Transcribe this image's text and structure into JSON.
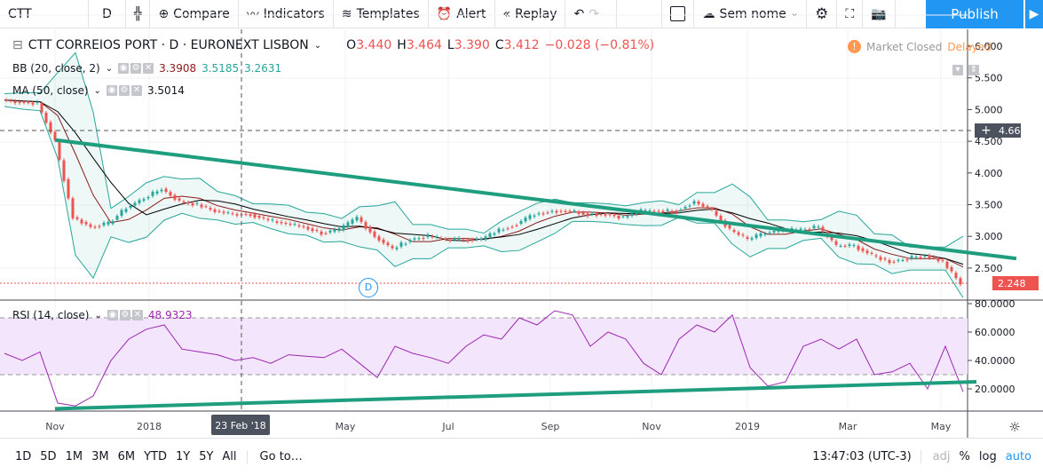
{
  "toolbar": {
    "symbol": "CTT",
    "interval": "D",
    "compare": "Compare",
    "indicators": "Indicators",
    "templates": "Templates",
    "alert": "Alert",
    "replay": "Replay",
    "layout_name": "Sem nome",
    "publish": "Publish"
  },
  "legend": {
    "title": "CTT CORREIOS PORT · D · EURONEXT LISBON",
    "o_label": "O",
    "o": "3.440",
    "h_label": "H",
    "h": "3.464",
    "l_label": "L",
    "l": "3.390",
    "c_label": "C",
    "c": "3.412",
    "change": "−0.028 (−0.81%)",
    "market_status": "Market Closed",
    "delayed": "Delayed",
    "bb": {
      "label": "BB (20, close, 2)",
      "basis": "3.3908",
      "upper": "3.5185",
      "lower": "3.2631"
    },
    "ma": {
      "label": "MA (50, close)",
      "value": "3.5014"
    },
    "rsi": {
      "label": "RSI (14, close)",
      "value": "48.9323"
    }
  },
  "price_axis": {
    "ticks": [
      "6.000",
      "5.500",
      "5.000",
      "4.500",
      "4.000",
      "3.500",
      "3.000",
      "2.500"
    ],
    "crosshair_label": "4.660",
    "last_price": "2.248"
  },
  "rsi_axis": {
    "ticks": [
      "80.0000",
      "60.0000",
      "40.0000",
      "20.0000"
    ]
  },
  "time_axis": {
    "ticks": [
      "Nov",
      "2018",
      "May",
      "Jul",
      "Sep",
      "Nov",
      "2019",
      "Mar",
      "May"
    ],
    "crosshair_label": "23 Feb '18"
  },
  "dividend_marker": "D",
  "bottom": {
    "ranges": [
      "1D",
      "5D",
      "1M",
      "3M",
      "6M",
      "YTD",
      "1Y",
      "5Y",
      "All"
    ],
    "goto": "Go to…",
    "clock": "13:47:03 (UTC-3)",
    "adj": "adj",
    "pct": "%",
    "log": "log",
    "auto": "auto"
  },
  "colors": {
    "up": "#26a69a",
    "down": "#ef5350",
    "trend": "#1e9e7e",
    "bb": "#26a69a",
    "rsi": "#9c27b0",
    "accent": "#2196f3"
  },
  "chart_data": {
    "type": "line",
    "title": "CTT CORREIOS PORT · D · EURONEXT LISBON",
    "ylim": [
      2.1,
      6.2
    ],
    "price_close": [
      5.15,
      5.12,
      5.1,
      4.5,
      3.3,
      3.15,
      3.2,
      3.45,
      3.6,
      3.75,
      3.55,
      3.5,
      3.4,
      3.35,
      3.35,
      3.25,
      3.2,
      3.15,
      3.05,
      3.1,
      3.3,
      3.0,
      2.8,
      2.95,
      3.0,
      2.95,
      2.95,
      2.95,
      3.1,
      3.2,
      3.35,
      3.4,
      3.4,
      3.35,
      3.35,
      3.3,
      3.4,
      3.4,
      3.4,
      3.55,
      3.4,
      3.1,
      2.95,
      3.05,
      3.1,
      3.1,
      3.15,
      2.85,
      2.85,
      2.7,
      2.6,
      2.65,
      2.7,
      2.6,
      2.25
    ],
    "rsi": [
      45,
      40,
      46,
      10,
      8,
      15,
      40,
      55,
      62,
      65,
      48,
      46,
      44,
      40,
      42,
      38,
      44,
      43,
      42,
      48,
      38,
      28,
      50,
      45,
      42,
      38,
      50,
      58,
      55,
      70,
      65,
      75,
      72,
      50,
      60,
      55,
      38,
      30,
      55,
      65,
      60,
      72,
      35,
      22,
      25,
      50,
      55,
      48,
      55,
      30,
      32,
      38,
      20,
      50,
      18
    ],
    "trendlines": [
      {
        "pane": "price",
        "from": 4.52,
        "to": 2.65
      },
      {
        "pane": "rsi",
        "from": 6,
        "to": 25
      }
    ],
    "rsi_bands": [
      70,
      30
    ]
  }
}
